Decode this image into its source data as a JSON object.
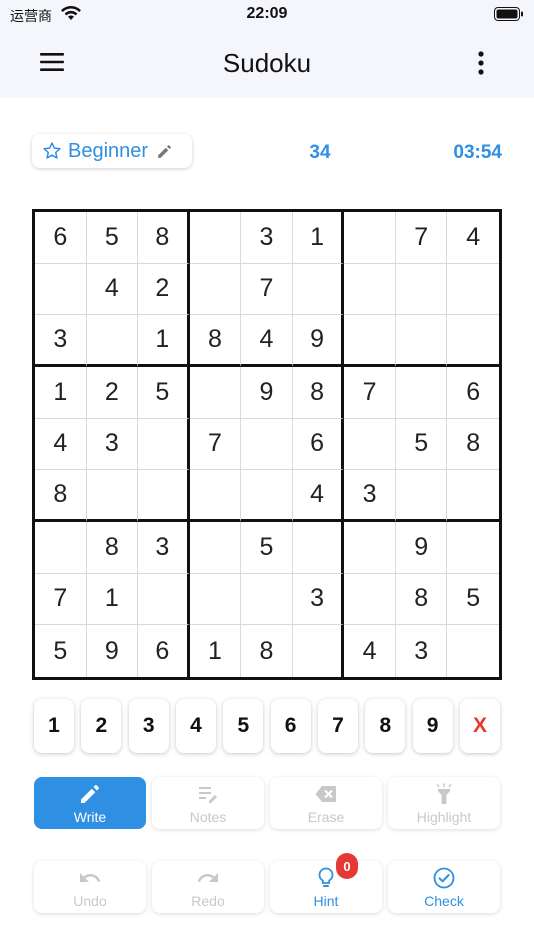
{
  "status_bar": {
    "carrier": "运营商",
    "time": "22:09"
  },
  "app_bar": {
    "title": "Sudoku"
  },
  "game_info": {
    "level": "Beginner",
    "score": "34",
    "timer": "03:54"
  },
  "board": [
    [
      "6",
      "5",
      "8",
      "",
      "3",
      "1",
      "",
      "7",
      "4"
    ],
    [
      "",
      "4",
      "2",
      "",
      "7",
      "",
      "",
      "",
      ""
    ],
    [
      "3",
      "",
      "1",
      "8",
      "4",
      "9",
      "",
      "",
      ""
    ],
    [
      "1",
      "2",
      "5",
      "",
      "9",
      "8",
      "7",
      "",
      "6"
    ],
    [
      "4",
      "3",
      "",
      "7",
      "",
      "6",
      "",
      "5",
      "8"
    ],
    [
      "8",
      "",
      "",
      "",
      "",
      "4",
      "3",
      "",
      ""
    ],
    [
      "",
      "8",
      "3",
      "",
      "5",
      "",
      "",
      "9",
      ""
    ],
    [
      "7",
      "1",
      "",
      "",
      "",
      "3",
      "",
      "8",
      "5"
    ],
    [
      "5",
      "9",
      "6",
      "1",
      "8",
      "",
      "4",
      "3",
      ""
    ]
  ],
  "number_pad": [
    "1",
    "2",
    "3",
    "4",
    "5",
    "6",
    "7",
    "8",
    "9"
  ],
  "clear_key": "X",
  "modes": {
    "write": "Write",
    "notes": "Notes",
    "erase": "Erase",
    "highlight": "Highlight"
  },
  "actions": {
    "undo": "Undo",
    "redo": "Redo",
    "hint": "Hint",
    "hint_count": "0",
    "check": "Check"
  },
  "colors": {
    "accent": "#2f8fe2",
    "danger": "#e53935",
    "disabled": "#c8c8c8",
    "bar_bg": "#f4f6fb"
  }
}
